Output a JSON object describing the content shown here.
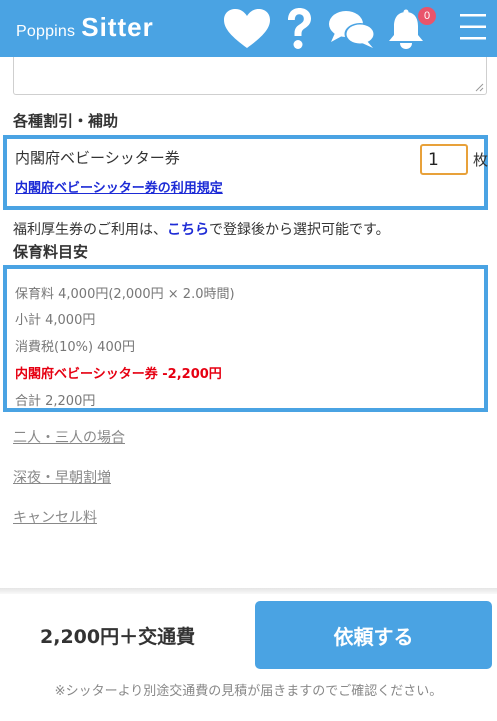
{
  "header": {
    "logo_small": "Poppins",
    "logo_big": "Sitter",
    "notification_count": "0",
    "colors": {
      "brand": "#4aa3e3",
      "badge": "#e9546b"
    },
    "icons": [
      "heart-icon",
      "question-icon",
      "chat-icon",
      "bell-icon",
      "menu-icon"
    ]
  },
  "discounts": {
    "title": "各種割引・補助",
    "coupon": {
      "label": "内閣府ベビーシッター券",
      "quantity": "1",
      "unit": "枚",
      "link": "内閣府ベビーシッター券の利用規定"
    },
    "welfare": {
      "before": "福利厚生券のご利用は、",
      "link": "こちら",
      "after": "で登録後から選択可能です。"
    }
  },
  "fee_estimate": {
    "title": "保育料目安",
    "lines": {
      "base": "保育料 4,000円(2,000円 × 2.0時間)",
      "subtotal": "小計 4,000円",
      "tax": "消費税(10%) 400円",
      "discount": "内閣府ベビーシッター券 -2,200円",
      "total": "合計 2,200円"
    }
  },
  "links": {
    "multiple": "二人・三人の場合",
    "night": "深夜・早朝割増",
    "cancel": "キャンセル料"
  },
  "footer": {
    "total": "2,200円＋交通費",
    "request_button": "依頼する",
    "note": "※シッターより別途交通費の見積が届きますのでご確認ください。"
  },
  "colors": {
    "discount_text": "#e60012",
    "link": "#1d2bd6",
    "input_border": "#e8a13a"
  }
}
